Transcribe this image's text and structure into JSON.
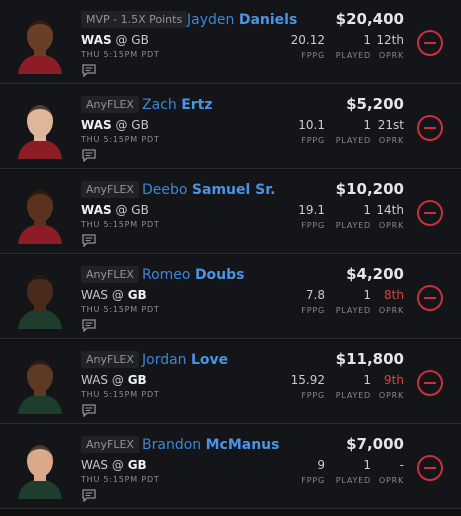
{
  "rows": [
    {
      "slot": "MVP - 1.5X Points",
      "first": "Jayden",
      "last": "Daniels",
      "salary": "$20,400",
      "team": "WAS",
      "at": "@",
      "opp": "GB",
      "bold_team": "team",
      "time": "THU 5:15PM PDT",
      "fppg": "20.12",
      "played": "1",
      "oprk": "12th",
      "oprk_status": "neutral",
      "fppg_label": "FPPG",
      "played_label": "PLAYED",
      "oprk_label": "OPRK",
      "jersey": "#8c1d26",
      "skin": "#6a3f26"
    },
    {
      "slot": "AnyFLEX",
      "first": "Zach",
      "last": "Ertz",
      "salary": "$5,200",
      "team": "WAS",
      "at": "@",
      "opp": "GB",
      "bold_team": "team",
      "time": "THU 5:15PM PDT",
      "fppg": "10.1",
      "played": "1",
      "oprk": "21st",
      "oprk_status": "neutral",
      "fppg_label": "FPPG",
      "played_label": "PLAYED",
      "oprk_label": "OPRK",
      "jersey": "#8c1d26",
      "skin": "#e0b69a"
    },
    {
      "slot": "AnyFLEX",
      "first": "Deebo",
      "last": "Samuel Sr.",
      "salary": "$10,200",
      "team": "WAS",
      "at": "@",
      "opp": "GB",
      "bold_team": "team",
      "time": "THU 5:15PM PDT",
      "fppg": "19.1",
      "played": "1",
      "oprk": "14th",
      "oprk_status": "neutral",
      "fppg_label": "FPPG",
      "played_label": "PLAYED",
      "oprk_label": "OPRK",
      "jersey": "#8c1d26",
      "skin": "#5a321e"
    },
    {
      "slot": "AnyFLEX",
      "first": "Romeo",
      "last": "Doubs",
      "salary": "$4,200",
      "team": "WAS",
      "at": "@",
      "opp": "GB",
      "bold_team": "opp",
      "time": "THU 5:15PM PDT",
      "fppg": "7.8",
      "played": "1",
      "oprk": "8th",
      "oprk_status": "bad",
      "fppg_label": "FPPG",
      "played_label": "PLAYED",
      "oprk_label": "OPRK",
      "jersey": "#1f3d2c",
      "skin": "#4a2a1a"
    },
    {
      "slot": "AnyFLEX",
      "first": "Jordan",
      "last": "Love",
      "salary": "$11,800",
      "team": "WAS",
      "at": "@",
      "opp": "GB",
      "bold_team": "opp",
      "time": "THU 5:15PM PDT",
      "fppg": "15.92",
      "played": "1",
      "oprk": "9th",
      "oprk_status": "bad",
      "fppg_label": "FPPG",
      "played_label": "PLAYED",
      "oprk_label": "OPRK",
      "jersey": "#1f3d2c",
      "skin": "#5c3a24"
    },
    {
      "slot": "AnyFLEX",
      "first": "Brandon",
      "last": "McManus",
      "salary": "$7,000",
      "team": "WAS",
      "at": "@",
      "opp": "GB",
      "bold_team": "opp",
      "time": "THU 5:15PM PDT",
      "fppg": "9",
      "played": "1",
      "oprk": "-",
      "oprk_status": "neutral",
      "fppg_label": "FPPG",
      "played_label": "PLAYED",
      "oprk_label": "OPRK",
      "jersey": "#1f3d2c",
      "skin": "#d9a98a"
    }
  ]
}
